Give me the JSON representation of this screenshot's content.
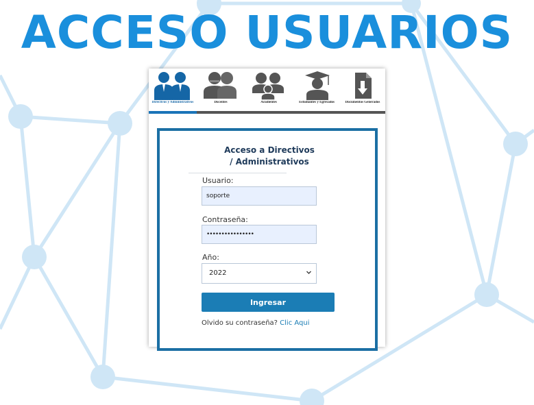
{
  "page": {
    "title": "ACCESO USUARIOS"
  },
  "colors": {
    "title": "#1a8fdc",
    "network": "#cfe6f6",
    "accent": "#1b7db5",
    "box_border": "#1b6fa4",
    "input_bg": "#e8f0fe"
  },
  "tabs": [
    {
      "label": "Directivos y Administrativos",
      "icon": "managers-icon",
      "active": true
    },
    {
      "label": "Docentes",
      "icon": "teachers-icon",
      "active": false
    },
    {
      "label": "Acudientes",
      "icon": "guardians-icon",
      "active": false
    },
    {
      "label": "Estudiantes y Egresados",
      "icon": "graduate-icon",
      "active": false
    },
    {
      "label": "Documentos Generados",
      "icon": "document-download-icon",
      "active": false
    }
  ],
  "login": {
    "title_line1": "Acceso a Directivos",
    "title_line2": "/ Administrativos",
    "user_label": "Usuario:",
    "user_value": "soporte",
    "password_label": "Contraseña:",
    "password_value": "••••••••••••••••",
    "year_label": "Año:",
    "year_value": "2022",
    "submit_label": "Ingresar",
    "forgot_text": "Olvido su contraseña?",
    "forgot_link": "Clic Aqui"
  }
}
